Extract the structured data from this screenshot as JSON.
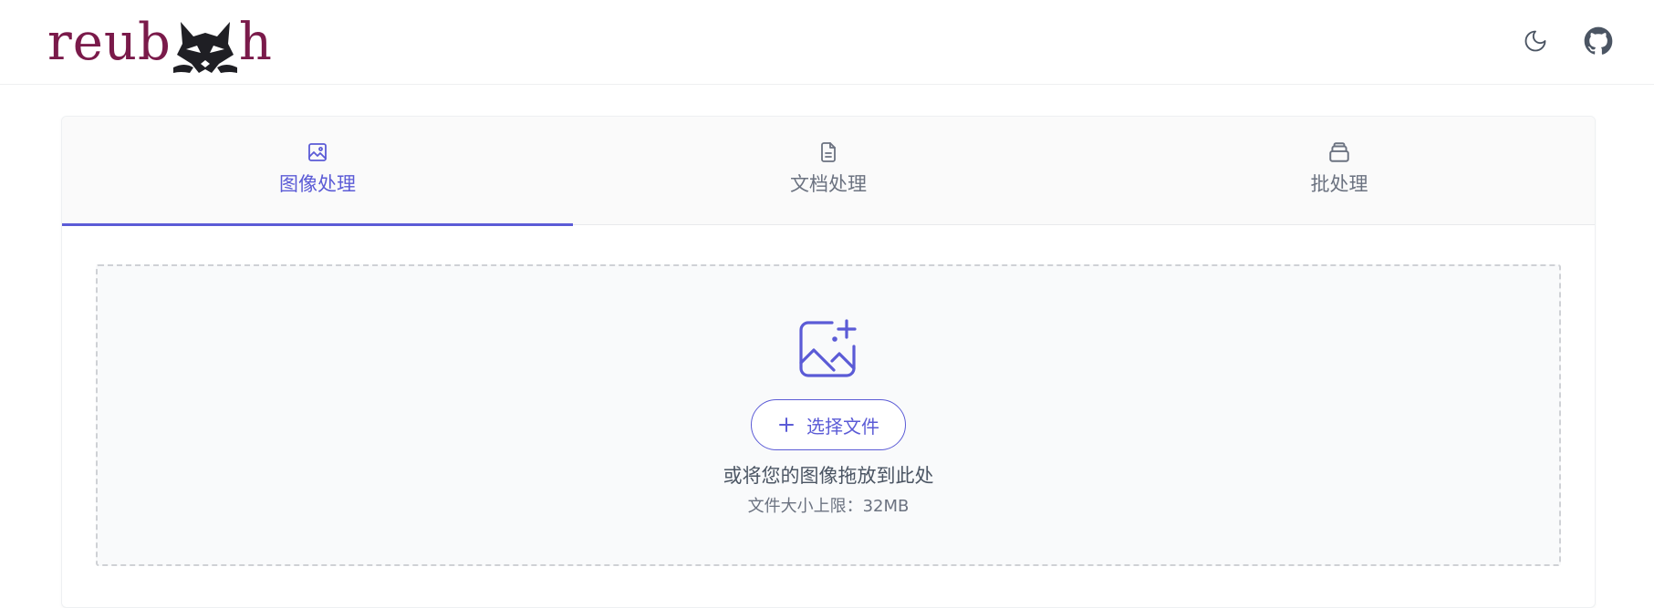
{
  "header": {
    "logo_left": "reub",
    "logo_right": "h",
    "theme_toggle_icon": "moon-icon",
    "github_icon": "github-icon"
  },
  "tabs": [
    {
      "label": "图像处理",
      "icon": "image-icon",
      "active": true
    },
    {
      "label": "文档处理",
      "icon": "document-icon",
      "active": false
    },
    {
      "label": "批处理",
      "icon": "stack-icon",
      "active": false
    }
  ],
  "dropzone": {
    "icon": "image-plus-icon",
    "button_label": "选择文件",
    "hint": "或将您的图像拖放到此处",
    "size_limit": "文件大小上限：32MB"
  },
  "colors": {
    "accent": "#5b5bd6",
    "logo": "#7a1a4a",
    "muted_text": "#6b7280"
  }
}
